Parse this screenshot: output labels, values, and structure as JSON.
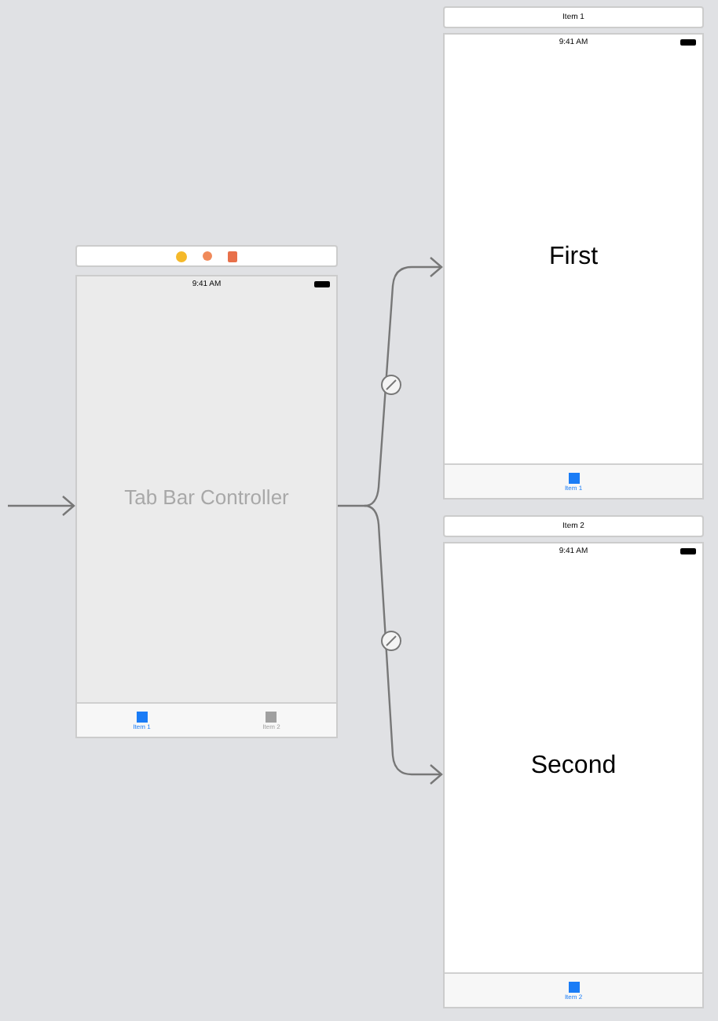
{
  "tab_bar_controller": {
    "status_time": "9:41 AM",
    "title": "Tab Bar Controller",
    "tabs": [
      {
        "label": "Item 1",
        "selected": true
      },
      {
        "label": "Item 2",
        "selected": false
      }
    ]
  },
  "scenes": [
    {
      "header": "Item 1",
      "status_time": "9:41 AM",
      "title": "First",
      "tabs": [
        {
          "label": "Item 1",
          "selected": true
        }
      ]
    },
    {
      "header": "Item 2",
      "status_time": "9:41 AM",
      "title": "Second",
      "tabs": [
        {
          "label": "Item 2",
          "selected": true
        }
      ]
    }
  ]
}
